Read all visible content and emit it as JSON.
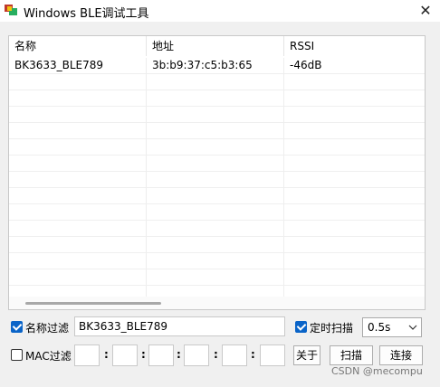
{
  "window": {
    "title": "Windows BLE调试工具",
    "close_glyph": "✕"
  },
  "device_list": {
    "columns": [
      "名称",
      "地址",
      "RSSI"
    ],
    "rows": [
      [
        "BK3633_BLE789",
        "3b:b9:37:c5:b3:65",
        "-46dB"
      ]
    ]
  },
  "filters": {
    "name_filter": {
      "label": "名称过滤",
      "checked": true,
      "value": "BK3633_BLE789"
    },
    "mac_filter": {
      "label": "MAC过滤",
      "checked": false,
      "octets": [
        "",
        "",
        "",
        "",
        "",
        ""
      ],
      "separator": ":"
    }
  },
  "scan_timer": {
    "label": "定时扫描",
    "checked": true,
    "interval": "0.5s"
  },
  "buttons": {
    "about": "关于",
    "scan": "扫描",
    "connect": "连接"
  },
  "watermark": "CSDN @mecompu"
}
